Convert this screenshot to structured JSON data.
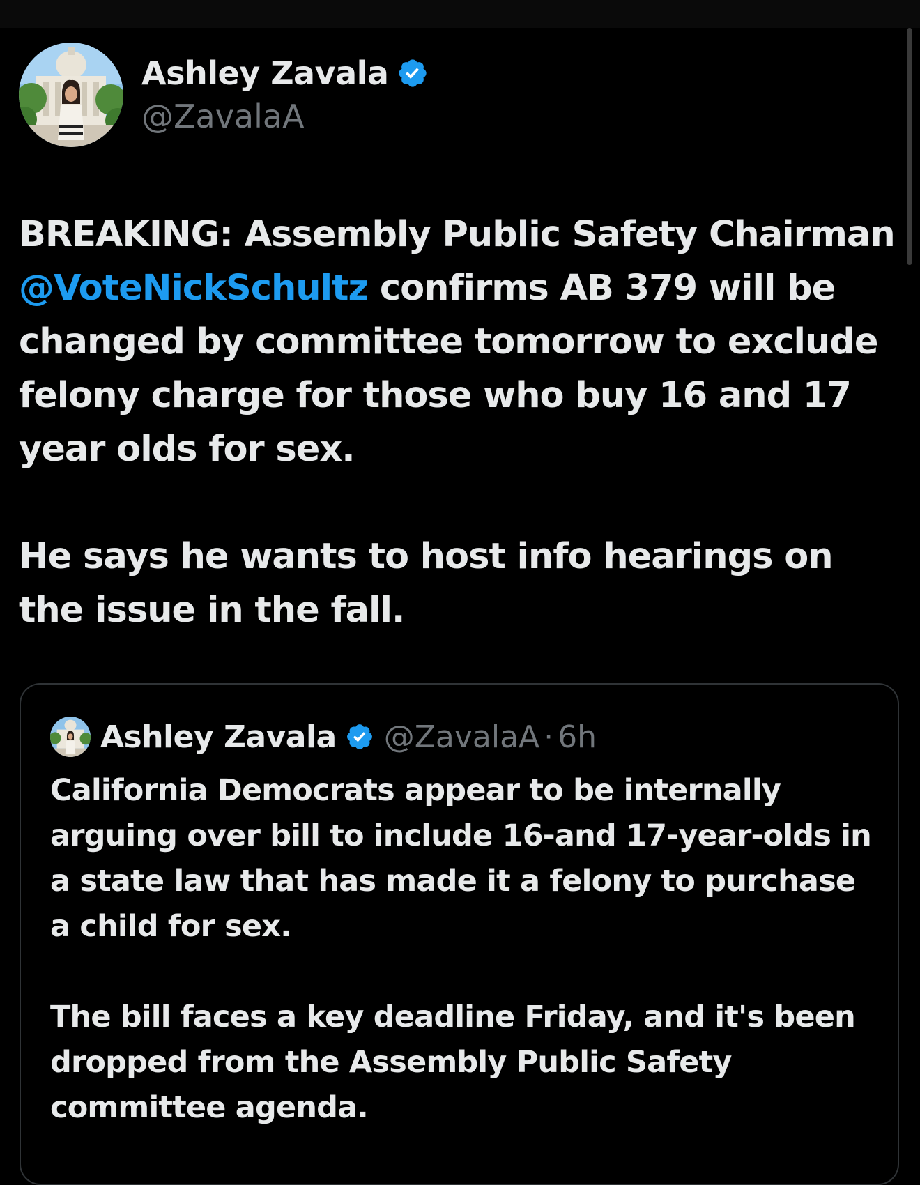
{
  "tweet": {
    "author": {
      "display_name": "Ashley Zavala",
      "handle": "@ZavalaA",
      "verified_icon": "verified-badge-icon"
    },
    "body": {
      "p1_prefix": "BREAKING: Assembly Public Safety Chairman ",
      "p1_mention": "@VoteNickSchultz",
      "p1_suffix": " confirms AB 379 will be changed by committee tomorrow to exclude felony charge for those who buy 16 and 17 year olds for sex.",
      "p2": "He says he wants to host info hearings on the issue in the fall."
    }
  },
  "quote": {
    "author": {
      "display_name": "Ashley Zavala",
      "handle": "@ZavalaA",
      "separator": "·",
      "time": "6h"
    },
    "body": {
      "p1": "California Democrats appear to be internally arguing over bill to include 16-and 17-year-olds in a state law that has made it a felony to purchase a child for sex.",
      "p2": "The bill faces a key deadline Friday, and it's been dropped from the Assembly Public Safety committee agenda."
    }
  },
  "colors": {
    "background": "#000000",
    "text": "#e7e9ea",
    "secondary_text": "#71767b",
    "link": "#1d9bf0",
    "verified": "#1d9bf0",
    "border": "#2f3336"
  }
}
